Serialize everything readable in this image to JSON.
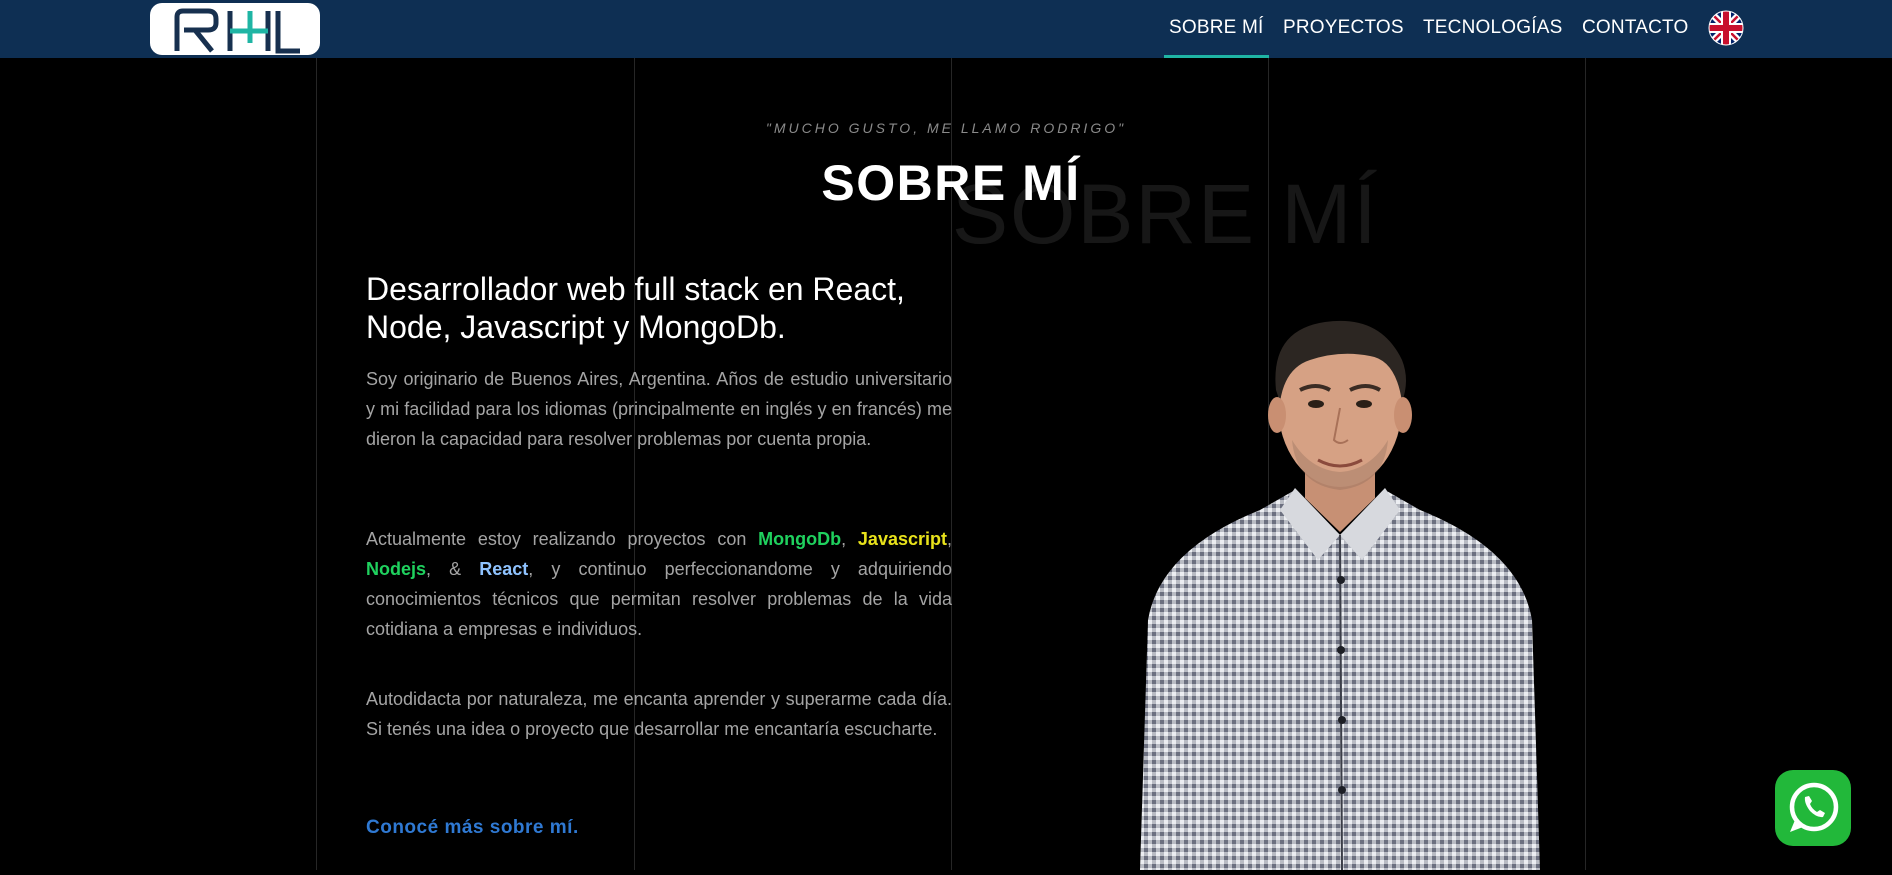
{
  "nav": {
    "items": [
      {
        "label": "SOBRE MÍ",
        "active": true
      },
      {
        "label": "PROYECTOS",
        "active": false
      },
      {
        "label": "TECNOLOGÍAS",
        "active": false
      },
      {
        "label": "CONTACTO",
        "active": false
      }
    ],
    "language_icon": "uk-flag-icon",
    "logo_icon": "rhl-logo",
    "accent_color": "#1fb5a4",
    "background_color": "#0e2f53"
  },
  "about": {
    "quote": "\"MUCHO GUSTO, ME LLAMO RODRIGO\"",
    "title": "SOBRE MÍ",
    "ghost_title": "SOBRE MÍ",
    "headline": "Desarrollador web full stack en React, Node, Javascript y MongoDb.",
    "p1": "Soy originario de Buenos Aires, Argentina. Años de estudio universitario y mi facilidad para los idiomas (principalmente en inglés y en francés) me dieron la capacidad para resolver problemas por cuenta propia.",
    "p2": {
      "intro": "Actualmente estoy realizando proyectos con ",
      "kw1": "MongoDb",
      "sep1": ", ",
      "kw2": "Javascript",
      "sep2": ", ",
      "kw3": "Nodejs",
      "sep3": ", & ",
      "kw4": "React",
      "rest": ", y continuo perfeccionandome y adquiriendo conocimientos técnicos que permitan resolver problemas de la vida cotidiana a empresas e individuos."
    },
    "p3": "Autodidacta por naturaleza, me encanta aprender y superarme cada día. Si tenés una idea o proyecto que desarrollar me encantaría escucharte.",
    "more_link": "Conocé más sobre mí."
  },
  "whatsapp_icon": "whatsapp-icon"
}
